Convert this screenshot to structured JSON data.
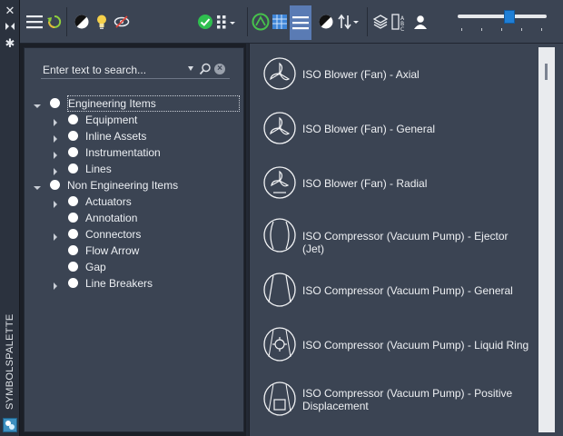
{
  "palette": {
    "title": "SYMBOLSPALETTE"
  },
  "search": {
    "placeholder": "Enter text to search..."
  },
  "tree": [
    {
      "label": "Engineering Items",
      "level": 0,
      "expanded": true,
      "selected": true
    },
    {
      "label": "Equipment",
      "level": 1,
      "has_children": true
    },
    {
      "label": "Inline Assets",
      "level": 1,
      "has_children": true
    },
    {
      "label": "Instrumentation",
      "level": 1,
      "has_children": true
    },
    {
      "label": "Lines",
      "level": 1,
      "has_children": true
    },
    {
      "label": "Non Engineering Items",
      "level": 0,
      "expanded": true
    },
    {
      "label": "Actuators",
      "level": 1,
      "has_children": true
    },
    {
      "label": "Annotation",
      "level": 1,
      "has_children": false
    },
    {
      "label": "Connectors",
      "level": 1,
      "has_children": true
    },
    {
      "label": "Flow Arrow",
      "level": 1,
      "has_children": false
    },
    {
      "label": "Gap",
      "level": 1,
      "has_children": false
    },
    {
      "label": "Line Breakers",
      "level": 1,
      "has_children": true
    }
  ],
  "symbols": [
    {
      "name": "ISO Blower (Fan) - Axial",
      "icon": "blower-axial-icon"
    },
    {
      "name": "ISO Blower (Fan) - General",
      "icon": "blower-general-icon"
    },
    {
      "name": "ISO Blower (Fan) - Radial",
      "icon": "blower-radial-icon"
    },
    {
      "name": "ISO Compressor (Vacuum Pump) - Ejector (Jet)",
      "icon": "compressor-ejector-icon"
    },
    {
      "name": "ISO Compressor (Vacuum Pump) - General",
      "icon": "compressor-general-icon"
    },
    {
      "name": "ISO Compressor (Vacuum Pump) - Liquid Ring",
      "icon": "compressor-liquid-ring-icon"
    },
    {
      "name": "ISO Compressor (Vacuum Pump) - Positive Displacement",
      "icon": "compressor-positive-displacement-icon"
    }
  ],
  "zoom_slider": {
    "level": 0.58
  },
  "colors": {
    "panel": "#3b4453",
    "accent": "#1f7fd6",
    "active_button": "#5a7bb4",
    "ok_green": "#2fbf4f"
  }
}
